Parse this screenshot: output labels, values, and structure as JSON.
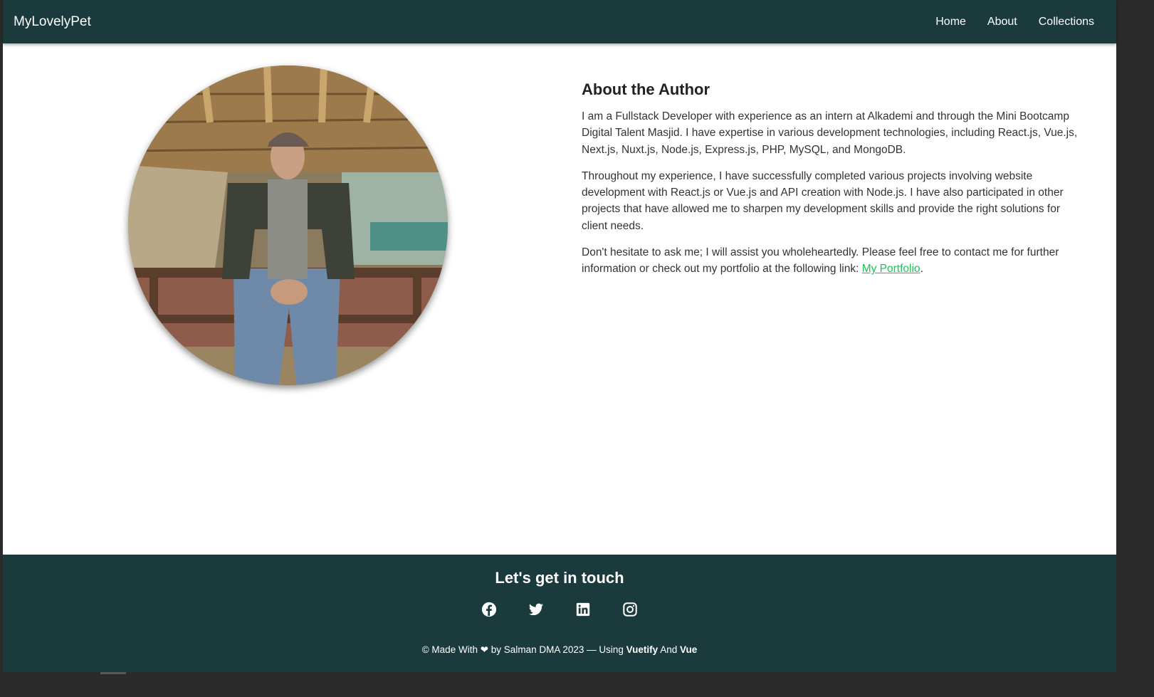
{
  "header": {
    "brand": "MyLovelyPet",
    "nav": [
      {
        "label": "Home"
      },
      {
        "label": "About"
      },
      {
        "label": "Collections"
      }
    ]
  },
  "main": {
    "photo_alt": "Author photo",
    "title": "About the Author",
    "paragraph_1": "I am a Fullstack Developer with experience as an intern at Alkademi and through the Mini Bootcamp Digital Talent Masjid. I have expertise in various development technologies, including React.js, Vue.js, Next.js, Nuxt.js, Node.js, Express.js, PHP, MySQL, and MongoDB.",
    "paragraph_2": "Throughout my experience, I have successfully completed various projects involving website development with React.js or Vue.js and API creation with Node.js. I have also participated in other projects that have allowed me to sharpen my development skills and provide the right solutions for client needs.",
    "paragraph_3_prefix": "Don't hesitate to ask me; I will assist you wholeheartedly. Please feel free to contact me for further information or check out my portfolio at the following link: ",
    "portfolio_link": "My Portfolio",
    "paragraph_3_suffix": "."
  },
  "footer": {
    "heading": "Let's get in touch",
    "socials": [
      {
        "icon": "facebook-icon"
      },
      {
        "icon": "twitter-icon"
      },
      {
        "icon": "linkedin-icon"
      },
      {
        "icon": "instagram-icon"
      }
    ],
    "copyright_prefix": "© Made With",
    "heart": "❤",
    "copyright_middle": "by Salman DMA 2023 — Using",
    "vuetify": "Vuetify",
    "and": "And",
    "vue": "Vue"
  },
  "colors": {
    "appbar": "#1b3a3c",
    "link": "#1fbf5a"
  }
}
